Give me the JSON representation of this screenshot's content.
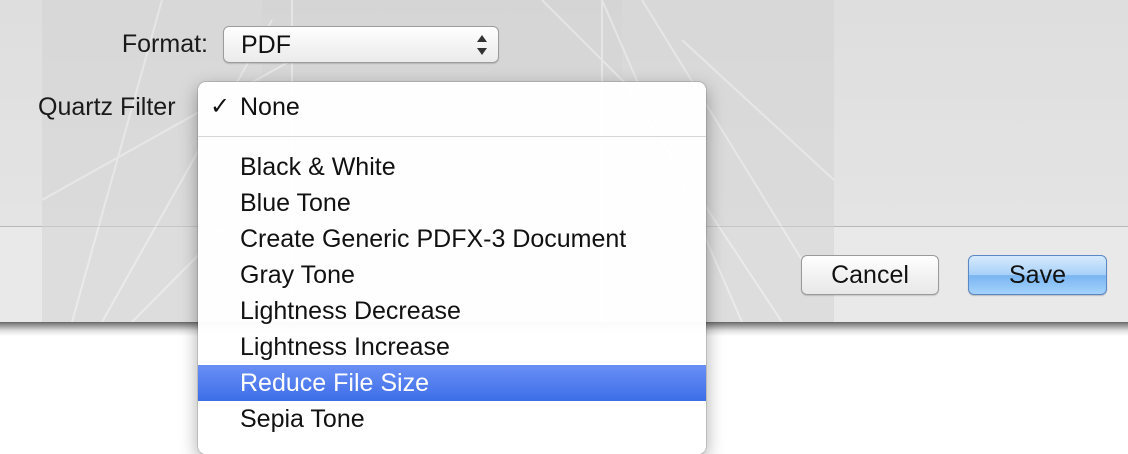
{
  "format": {
    "label": "Format:",
    "selected": "PDF"
  },
  "quartz_filter": {
    "label": "Quartz Filter",
    "checkmark": "✓",
    "menu_items": [
      {
        "label": "None",
        "checked": true,
        "highlighted": false
      },
      {
        "label": "Black & White",
        "checked": false,
        "highlighted": false
      },
      {
        "label": "Blue Tone",
        "checked": false,
        "highlighted": false
      },
      {
        "label": "Create Generic PDFX-3 Document",
        "checked": false,
        "highlighted": false
      },
      {
        "label": "Gray Tone",
        "checked": false,
        "highlighted": false
      },
      {
        "label": "Lightness Decrease",
        "checked": false,
        "highlighted": false
      },
      {
        "label": "Lightness Increase",
        "checked": false,
        "highlighted": false
      },
      {
        "label": "Reduce File Size",
        "checked": false,
        "highlighted": true
      },
      {
        "label": "Sepia Tone",
        "checked": false,
        "highlighted": false
      }
    ]
  },
  "buttons": {
    "cancel": "Cancel",
    "save": "Save"
  },
  "colors": {
    "highlight": "#3d6ee8",
    "default_button": "#79b5f2"
  }
}
